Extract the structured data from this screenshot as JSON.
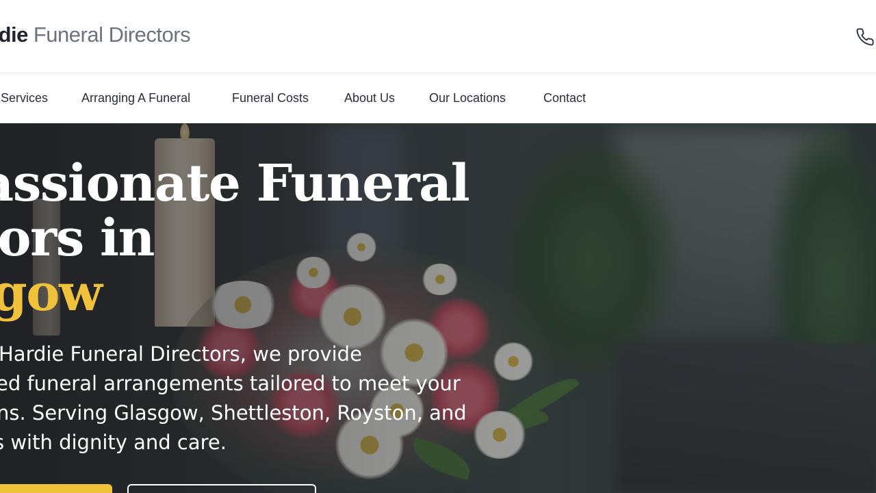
{
  "header": {
    "logo_bold": "rdie",
    "logo_light": "Funeral Directors",
    "phone_icon": "phone-icon"
  },
  "nav": {
    "items": [
      {
        "label": "Services"
      },
      {
        "label": "Arranging A Funeral"
      },
      {
        "label": "Funeral Costs"
      },
      {
        "label": "About Us"
      },
      {
        "label": "Our Locations"
      },
      {
        "label": "Contact"
      }
    ]
  },
  "hero": {
    "title_line1": "passionate Funeral",
    "title_line2": "ctors in",
    "title_line3": "gow",
    "text_line1": "Hardie Funeral Directors, we provide",
    "text_line2": "ed funeral arrangements tailored to meet your",
    "text_line3": "ns. Serving Glasgow, Shettleston, Royston, and",
    "text_line4": "s with dignity and care.",
    "accent_color": "#f0c23c"
  },
  "colors": {
    "brand_dark": "#1f2430",
    "brand_grey": "#6b7380",
    "accent": "#f0c23c"
  }
}
